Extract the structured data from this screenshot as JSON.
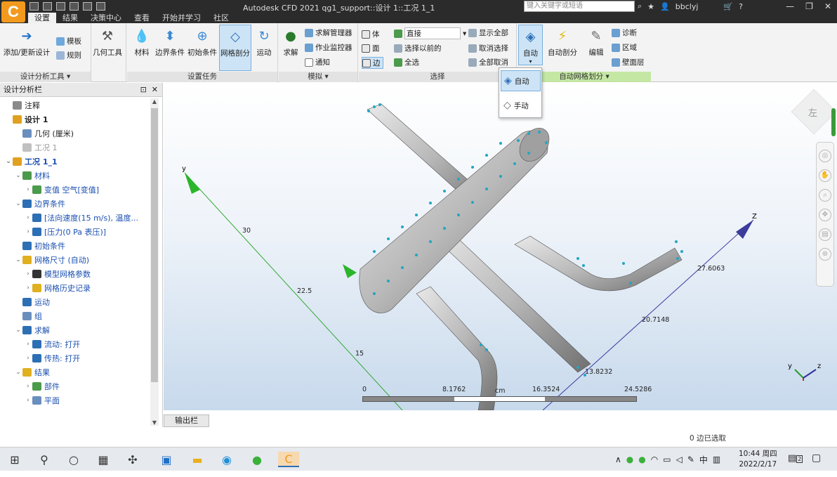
{
  "app": {
    "title": "Autodesk CFD 2021    qg1_support::设计 1::工况 1_1",
    "logo_letter": "C",
    "search_placeholder": "键入关键字或短语",
    "user": "bbclyj",
    "help": "?"
  },
  "menu_tabs": [
    "设置",
    "结果",
    "决策中心",
    "查看",
    "开始并学习",
    "社区"
  ],
  "ribbon": {
    "groups": [
      {
        "label": "设计分析工具",
        "buttons": [
          "添加/更新设计",
          "模板",
          "规则",
          "几何工具"
        ]
      },
      {
        "label": "设置任务",
        "buttons": [
          "材料",
          "边界条件",
          "初始条件",
          "网格剖分",
          "运动"
        ]
      },
      {
        "label": "模拟",
        "buttons": [
          "求解",
          "求解管理器",
          "作业监控器",
          "通知"
        ]
      },
      {
        "label": "选择",
        "buttons": [
          "体",
          "面",
          "边",
          "直接",
          "选择以前的",
          "全选",
          "显示全部",
          "取消选择",
          "全部取消"
        ]
      },
      {
        "label": "自动网格划分",
        "buttons": [
          "自动",
          "自动剖分",
          "编辑",
          "诊断",
          "区域",
          "壁面层"
        ]
      }
    ],
    "auto_menu": {
      "items": [
        "自动",
        "手动"
      ]
    }
  },
  "left_panel": {
    "title": "设计分析栏",
    "tree": [
      {
        "label": "注释",
        "style": "normal",
        "indent": 0,
        "toggle": ""
      },
      {
        "label": "设计 1",
        "style": "bold",
        "indent": 0,
        "toggle": ""
      },
      {
        "label": "几何 (厘米)",
        "style": "normal",
        "indent": 1,
        "toggle": ""
      },
      {
        "label": "工况 1",
        "style": "grey",
        "indent": 1,
        "toggle": ""
      },
      {
        "label": "工况 1_1",
        "style": "boldblue",
        "indent": 0,
        "toggle": "v"
      },
      {
        "label": "材料",
        "style": "blue",
        "indent": 1,
        "toggle": "v"
      },
      {
        "label": "变值 空气[变值]",
        "style": "blue",
        "indent": 2,
        "toggle": ">"
      },
      {
        "label": "边界条件",
        "style": "blue",
        "indent": 1,
        "toggle": "v"
      },
      {
        "label": "[法向速度(15 m/s), 温度...",
        "style": "blue",
        "indent": 2,
        "toggle": ">"
      },
      {
        "label": "[压力(0 Pa 表压)]",
        "style": "blue",
        "indent": 2,
        "toggle": ">"
      },
      {
        "label": "初始条件",
        "style": "blue",
        "indent": 1,
        "toggle": ""
      },
      {
        "label": "网格尺寸 (自动)",
        "style": "blue",
        "indent": 1,
        "toggle": "v"
      },
      {
        "label": "模型网格参数",
        "style": "blue",
        "indent": 2,
        "toggle": ">"
      },
      {
        "label": "网格历史记录",
        "style": "blue",
        "indent": 2,
        "toggle": ">"
      },
      {
        "label": "运动",
        "style": "blue",
        "indent": 1,
        "toggle": ""
      },
      {
        "label": "组",
        "style": "blue",
        "indent": 1,
        "toggle": ""
      },
      {
        "label": "求解",
        "style": "blue",
        "indent": 1,
        "toggle": "v"
      },
      {
        "label": "流动: 打开",
        "style": "blue",
        "indent": 2,
        "toggle": ">"
      },
      {
        "label": "传热: 打开",
        "style": "blue",
        "indent": 2,
        "toggle": ">"
      },
      {
        "label": "结果",
        "style": "blue",
        "indent": 1,
        "toggle": "v"
      },
      {
        "label": "部件",
        "style": "blue",
        "indent": 2,
        "toggle": ">"
      },
      {
        "label": "平面",
        "style": "blue",
        "indent": 2,
        "toggle": ">"
      }
    ]
  },
  "viewport": {
    "axis_labels": {
      "y": "y",
      "z": "Z"
    },
    "y_ticks": [
      "30",
      "22.5",
      "15"
    ],
    "z_ticks": [
      "27.6063",
      "20.7148",
      "13.8232"
    ],
    "scale_bar": {
      "labels": [
        "0",
        "8.1762",
        "16.3524",
        "24.5286"
      ],
      "unit": "cm"
    },
    "viewcube_label": "左",
    "triad": {
      "y": "y",
      "z": "z"
    }
  },
  "bottom_tab": "输出栏",
  "status": "0 边已选取",
  "taskbar": {
    "time": "10:44 周四",
    "date": "2022/2/17",
    "ime": "中",
    "notifications": "2"
  },
  "colors": {
    "accent": "#f39a1e",
    "mesh_node": "#22a6c2",
    "pipe": "#a8a8a8",
    "green_group": "#c5e7a4"
  }
}
